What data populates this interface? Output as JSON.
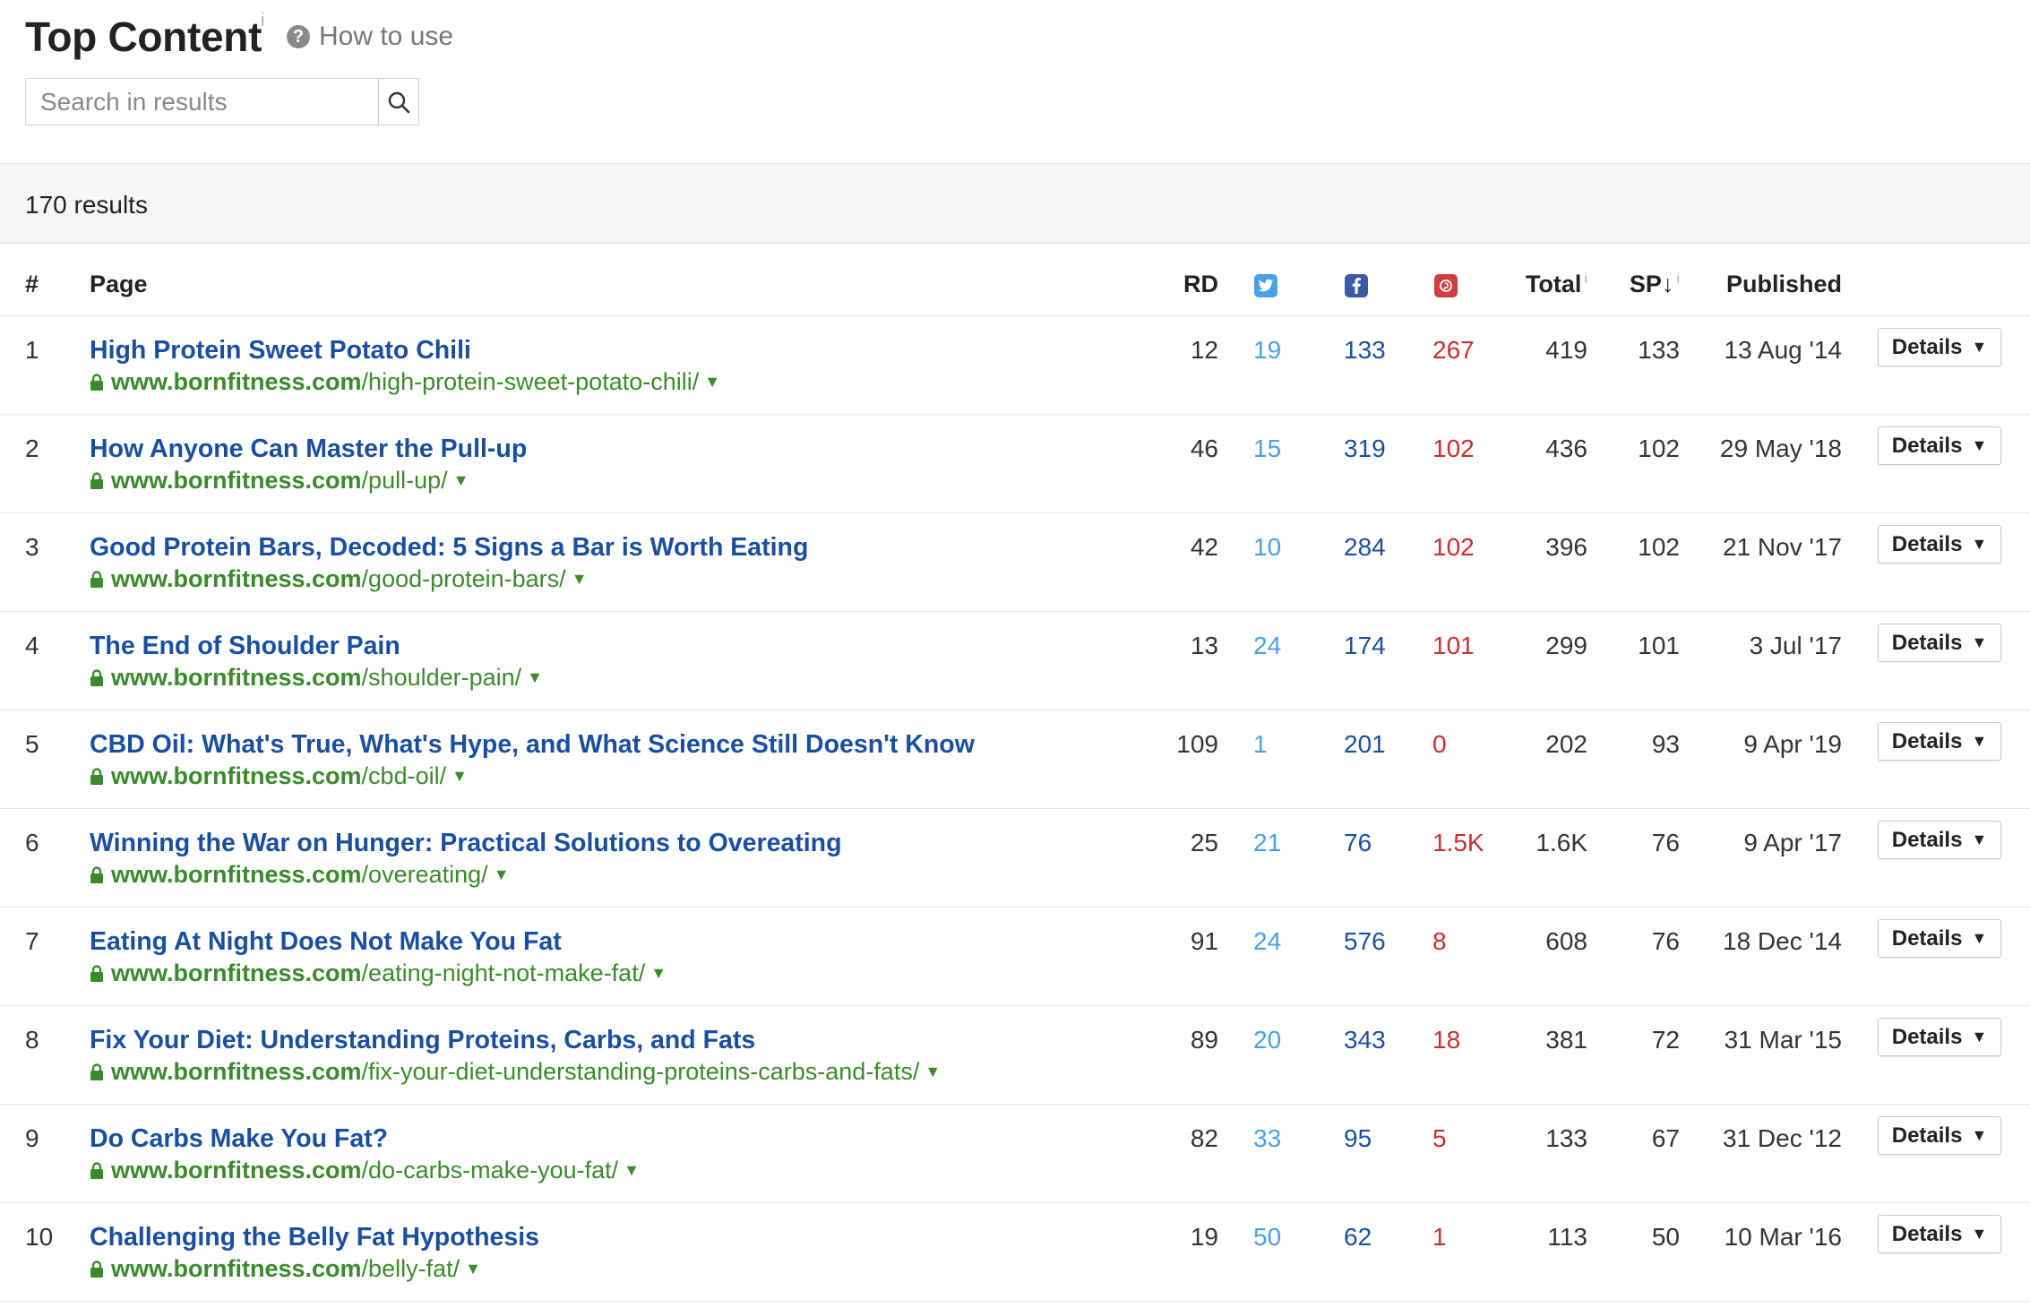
{
  "header": {
    "title": "Top Content",
    "title_info": "i",
    "help_icon_text": "?",
    "help_label": "How to use"
  },
  "search": {
    "placeholder": "Search in results",
    "value": ""
  },
  "results": {
    "count_label": "170 results"
  },
  "table": {
    "columns": {
      "num": "#",
      "page": "Page",
      "rd": "RD",
      "total": "Total",
      "sp": "SP",
      "sp_sort": "↓",
      "published": "Published",
      "info": "i"
    },
    "social_icons": [
      "twitter-icon",
      "facebook-icon",
      "pinterest-icon"
    ],
    "details_label": "Details",
    "details_caret": "▼",
    "url_caret": "▼",
    "rows": [
      {
        "num": "1",
        "title": "High Protein Sweet Potato Chili",
        "domain": "www.bornfitness.com",
        "path": "/high-protein-sweet-potato-chili/",
        "rd": "12",
        "tw": "19",
        "fb": "133",
        "pi": "267",
        "total": "419",
        "sp": "133",
        "published": "13 Aug '14"
      },
      {
        "num": "2",
        "title": "How Anyone Can Master the Pull-up",
        "domain": "www.bornfitness.com",
        "path": "/pull-up/",
        "rd": "46",
        "tw": "15",
        "fb": "319",
        "pi": "102",
        "total": "436",
        "sp": "102",
        "published": "29 May '18"
      },
      {
        "num": "3",
        "title": "Good Protein Bars, Decoded: 5 Signs a Bar is Worth Eating",
        "domain": "www.bornfitness.com",
        "path": "/good-protein-bars/",
        "rd": "42",
        "tw": "10",
        "fb": "284",
        "pi": "102",
        "total": "396",
        "sp": "102",
        "published": "21 Nov '17"
      },
      {
        "num": "4",
        "title": "The End of Shoulder Pain",
        "domain": "www.bornfitness.com",
        "path": "/shoulder-pain/",
        "rd": "13",
        "tw": "24",
        "fb": "174",
        "pi": "101",
        "total": "299",
        "sp": "101",
        "published": "3 Jul '17"
      },
      {
        "num": "5",
        "title": "CBD Oil: What's True, What's Hype, and What Science Still Doesn't Know",
        "domain": "www.bornfitness.com",
        "path": "/cbd-oil/",
        "rd": "109",
        "tw": "1",
        "fb": "201",
        "pi": "0",
        "total": "202",
        "sp": "93",
        "published": "9 Apr '19"
      },
      {
        "num": "6",
        "title": "Winning the War on Hunger: Practical Solutions to Overeating",
        "domain": "www.bornfitness.com",
        "path": "/overeating/",
        "rd": "25",
        "tw": "21",
        "fb": "76",
        "pi": "1.5K",
        "total": "1.6K",
        "sp": "76",
        "published": "9 Apr '17"
      },
      {
        "num": "7",
        "title": "Eating At Night Does Not Make You Fat",
        "domain": "www.bornfitness.com",
        "path": "/eating-night-not-make-fat/",
        "rd": "91",
        "tw": "24",
        "fb": "576",
        "pi": "8",
        "total": "608",
        "sp": "76",
        "published": "18 Dec '14"
      },
      {
        "num": "8",
        "title": "Fix Your Diet: Understanding Proteins, Carbs, and Fats",
        "domain": "www.bornfitness.com",
        "path": "/fix-your-diet-understanding-proteins-carbs-and-fats/",
        "rd": "89",
        "tw": "20",
        "fb": "343",
        "pi": "18",
        "total": "381",
        "sp": "72",
        "published": "31 Mar '15"
      },
      {
        "num": "9",
        "title": "Do Carbs Make You Fat?",
        "domain": "www.bornfitness.com",
        "path": "/do-carbs-make-you-fat/",
        "rd": "82",
        "tw": "33",
        "fb": "95",
        "pi": "5",
        "total": "133",
        "sp": "67",
        "published": "31 Dec '12"
      },
      {
        "num": "10",
        "title": "Challenging the Belly Fat Hypothesis",
        "domain": "www.bornfitness.com",
        "path": "/belly-fat/",
        "rd": "19",
        "tw": "50",
        "fb": "62",
        "pi": "1",
        "total": "113",
        "sp": "50",
        "published": "10 Mar '16"
      }
    ]
  },
  "colors": {
    "title_link": "#1a4fa0",
    "url_green": "#3b8a2c",
    "twitter": "#4aa0e8",
    "facebook": "#3b5ba8",
    "pinterest": "#c8302f"
  }
}
